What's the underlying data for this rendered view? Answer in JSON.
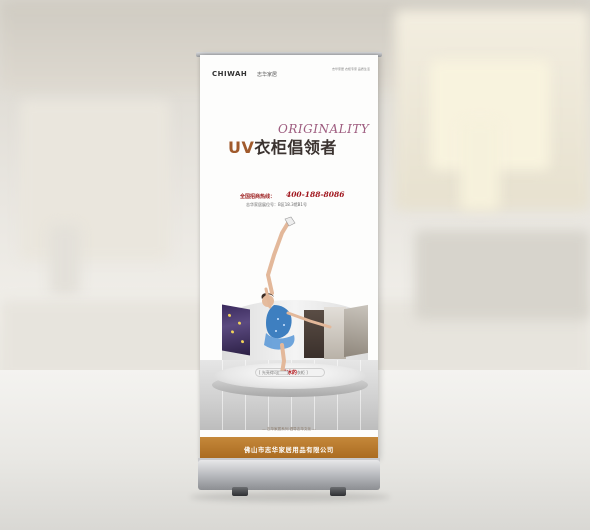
{
  "banner": {
    "brand_logo": "CHIWAH",
    "brand_cn": "志华家居",
    "tagline_small": "志华家居 衣柜专家 品质生活",
    "headline_script": "ORIGINALITY",
    "headline_uv": "UV",
    "headline_cn": "衣柜倡领者",
    "hotline_label": "全国招商热线：",
    "hotline_number": "400-188-8086",
    "address": "志华家居展位号：B区18.3馆B1号",
    "stage_text_prefix": "[ 光亮得可以",
    "stage_text_highlight": "滑冰的",
    "stage_text_suffix": "衣柜 ]",
    "bottom_slogan": "— 志华家居系列  倡导志华文化 —",
    "company_name": "佛山市志华家居用品有限公司"
  },
  "colors": {
    "accent_gold": "#b87a2f",
    "headline_red": "#a0151d",
    "script_purple": "#9d5b7e"
  }
}
